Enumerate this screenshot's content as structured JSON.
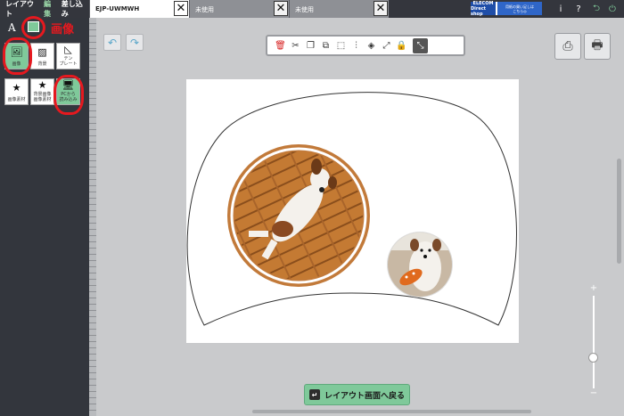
{
  "menu": {
    "layout": "レイアウト",
    "edit": "編集",
    "insert": "差し込み"
  },
  "tabs": [
    {
      "label": "EJP-UWMWH",
      "close": "✕"
    },
    {
      "label": "未使用",
      "close": "✕"
    },
    {
      "label": "未使用",
      "close": "✕"
    }
  ],
  "elecom": {
    "logo_line1": "ELECOM",
    "logo_line2": "Direct shop",
    "promo_line1": "用紙の買い足しは",
    "promo_line2": "こちら◎"
  },
  "top_icons": {
    "info": "i",
    "help": "?",
    "back": "⮌",
    "exit": "⏻"
  },
  "sidebar": {
    "text_icon": "A",
    "annotation": "画像",
    "tools": [
      {
        "label": "画像",
        "icon": "🖼"
      },
      {
        "label": "背景",
        "icon": "▨"
      },
      {
        "label": "テン\nプレート",
        "icon": "◺"
      },
      {
        "label": "画像素材",
        "icon": "★"
      },
      {
        "label": "背景画像\n画像素材",
        "icon": "★"
      },
      {
        "label": "PCから\n読み込み",
        "icon": "🖥"
      }
    ]
  },
  "toolbar_icons": [
    "🗑",
    "✂",
    "❐",
    "⧉",
    "⬚",
    "⫶",
    "◈",
    "⤢",
    "🔒",
    "⤡"
  ],
  "back_button": {
    "label": "レイアウト画面へ戻る",
    "icon": "↵"
  },
  "zoom": {
    "plus": "+",
    "minus": "−",
    "level": 0.36
  },
  "colors": {
    "accent_green": "#7fc99a",
    "annotation_red": "#e5191f",
    "dark_bg": "#33363d"
  }
}
